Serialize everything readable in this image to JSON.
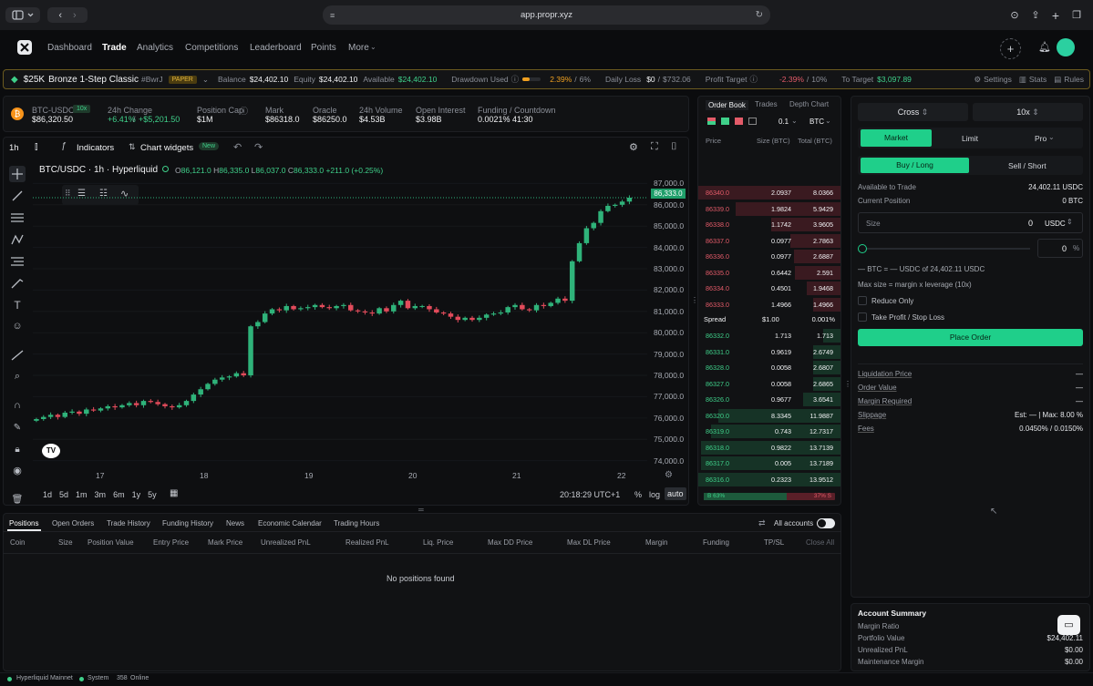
{
  "browser": {
    "url": "app.propr.xyz"
  },
  "nav": {
    "items": [
      "Dashboard",
      "Trade",
      "Analytics",
      "Competitions",
      "Leaderboard",
      "Points",
      "More"
    ],
    "active": "Trade"
  },
  "account": {
    "plan": "$25K",
    "challenge": "Bronze 1-Step Classic",
    "tag": "#BwrJ",
    "badge": "PAPER",
    "balance_label": "Balance",
    "balance": "$24,402.10",
    "equity_label": "Equity",
    "equity": "$24,402.10",
    "available_label": "Available",
    "available": "$24,402.10",
    "drawdown_label": "Drawdown Used",
    "drawdown_pct": "2.39%",
    "drawdown_max": "6%",
    "drawdown_fill": 0.4,
    "daily_loss_label": "Daily Loss",
    "daily_loss": "$0",
    "daily_loss_max": "$732.06",
    "profit_target_label": "Profit Target",
    "profit_target_pct": "-2.39%",
    "profit_target_max": "10%",
    "to_target_label": "To Target",
    "to_target": "$3,097.89",
    "settings": "Settings",
    "stats": "Stats",
    "rules": "Rules"
  },
  "ticker": {
    "pair": "BTC-USDC",
    "leverage": "10x",
    "price": "$86,320.50",
    "change_label": "24h Change",
    "change_pct": "+6.41%",
    "change_abs": "+$5,201.50",
    "cap_label": "Position Cap",
    "cap": "$1M",
    "mark_label": "Mark",
    "mark": "$86318.0",
    "oracle_label": "Oracle",
    "oracle": "$86250.0",
    "volume_label": "24h Volume",
    "volume": "$4.53B",
    "oi_label": "Open Interest",
    "oi": "$3.98B",
    "funding_label": "Funding / Countdown",
    "funding": "0.0021%",
    "countdown": "41:30"
  },
  "chart_toolbar": {
    "interval": "1h",
    "indicators": "Indicators",
    "widgets": "Chart widgets",
    "new_badge": "New"
  },
  "chart_legend": {
    "symbol": "BTC/USDC · 1h · Hyperliquid",
    "o": "86,121.0",
    "h": "86,335.0",
    "l": "86,037.0",
    "c": "86,333.0",
    "chg": "+211.0 (+0.25%)"
  },
  "chart_footer": {
    "ranges": [
      "1d",
      "5d",
      "1m",
      "3m",
      "6m",
      "1y",
      "5y"
    ],
    "time": "20:18:29 UTC+1",
    "pct": "%",
    "log": "log",
    "auto": "auto"
  },
  "chart_data": {
    "type": "candlestick",
    "y_ticks": [
      "87,000.0",
      "86,000.0",
      "85,000.0",
      "84,000.0",
      "83,000.0",
      "82,000.0",
      "81,000.0",
      "80,000.0",
      "79,000.0",
      "78,000.0",
      "77,000.0",
      "76,000.0",
      "75,000.0",
      "74,000.0"
    ],
    "y_tick_values": [
      87000,
      86000,
      85000,
      84000,
      83000,
      82000,
      81000,
      80000,
      79000,
      78000,
      77000,
      76000,
      75000,
      74000
    ],
    "x_ticks": [
      "17",
      "18",
      "19",
      "20",
      "21",
      "22"
    ],
    "ylim": [
      73600,
      87700
    ],
    "last_price": "86,333.0",
    "up_color": "#2fb37a",
    "down_color": "#e24b5b",
    "closes": [
      75950,
      76050,
      76150,
      76050,
      76250,
      76300,
      76200,
      76400,
      76350,
      76450,
      76550,
      76500,
      76600,
      76700,
      76600,
      76800,
      76750,
      76650,
      76550,
      76500,
      76600,
      76800,
      77100,
      77350,
      77600,
      77800,
      77900,
      77950,
      78100,
      78000,
      80300,
      80500,
      80900,
      81100,
      81050,
      81250,
      81100,
      81150,
      81200,
      81300,
      81200,
      81150,
      81250,
      81300,
      81050,
      81000,
      80950,
      80900,
      81150,
      81000,
      81300,
      81500,
      81150,
      81250,
      81250,
      81100,
      80950,
      80900,
      80750,
      80600,
      80700,
      80600,
      80700,
      80850,
      80900,
      80950,
      81200,
      81300,
      81100,
      81050,
      81300,
      81250,
      81400,
      81600,
      81500,
      83350,
      84200,
      84900,
      85150,
      85700,
      85950,
      86000,
      86150,
      86333
    ]
  },
  "orderbook": {
    "tabs": [
      "Order Book",
      "Trades",
      "Depth Chart"
    ],
    "tick": "0.1",
    "unit": "BTC",
    "headers": [
      "Price",
      "Size (BTC)",
      "Total (BTC)"
    ],
    "asks": [
      [
        "86340.0",
        "2.0937",
        "8.0366",
        1.0
      ],
      [
        "86339.0",
        "1.9824",
        "5.9429",
        0.74
      ],
      [
        "86338.0",
        "1.1742",
        "3.9605",
        0.49
      ],
      [
        "86337.0",
        "0.0977",
        "2.7863",
        0.35
      ],
      [
        "86336.0",
        "0.0977",
        "2.6887",
        0.33
      ],
      [
        "86335.0",
        "0.6442",
        "2.591",
        0.32
      ],
      [
        "86334.0",
        "0.4501",
        "1.9468",
        0.24
      ],
      [
        "86333.0",
        "1.4966",
        "1.4966",
        0.19
      ]
    ],
    "spread_label": "Spread",
    "spread": "$1.00",
    "spread_pct": "0.001%",
    "bids": [
      [
        "86332.0",
        "1.713",
        "1.713",
        0.12
      ],
      [
        "86331.0",
        "0.9619",
        "2.6749",
        0.19
      ],
      [
        "86328.0",
        "0.0058",
        "2.6807",
        0.19
      ],
      [
        "86327.0",
        "0.0058",
        "2.6865",
        0.19
      ],
      [
        "86326.0",
        "0.9677",
        "3.6541",
        0.26
      ],
      [
        "86320.0",
        "8.3345",
        "11.9887",
        0.86
      ],
      [
        "86319.0",
        "0.743",
        "12.7317",
        0.91
      ],
      [
        "86318.0",
        "0.9822",
        "13.7139",
        0.98
      ],
      [
        "86317.0",
        "0.005",
        "13.7189",
        0.98
      ],
      [
        "86316.0",
        "0.2323",
        "13.9512",
        1.0
      ]
    ],
    "buy_pct": "B 63%",
    "sell_pct": "37% S",
    "buy_frac": 0.63
  },
  "order_form": {
    "margin_mode": "Cross",
    "leverage": "10x",
    "types": [
      "Market",
      "Limit",
      "Pro"
    ],
    "sides": [
      "Buy / Long",
      "Sell / Short"
    ],
    "available_label": "Available to Trade",
    "available": "24,402.11 USDC",
    "position_label": "Current Position",
    "position": "0 BTC",
    "size_label": "Size",
    "size_value": "0",
    "size_unit": "USDC",
    "pct_value": "0",
    "pct_unit": "%",
    "conversion": "— BTC = — USDC of 24,402.11 USDC",
    "max_size": "Max size = margin x leverage (10x)",
    "reduce_only": "Reduce Only",
    "tpsl": "Take Profit / Stop Loss",
    "submit": "Place Order",
    "details": [
      [
        "Liquidation Price",
        "—"
      ],
      [
        "Order Value",
        "—"
      ],
      [
        "Margin Required",
        "—"
      ],
      [
        "Slippage",
        "Est: — | Max: 8.00 %"
      ],
      [
        "Fees",
        "0.0450% / 0.0150%"
      ]
    ]
  },
  "account_summary": {
    "title": "Account Summary",
    "rows": [
      [
        "Margin Ratio",
        ""
      ],
      [
        "Portfolio Value",
        "$24,402.11"
      ],
      [
        "Unrealized PnL",
        "$0.00"
      ],
      [
        "Maintenance Margin",
        "$0.00"
      ]
    ]
  },
  "positions": {
    "tabs": [
      "Positions",
      "Open Orders",
      "Trade History",
      "Funding History",
      "News",
      "Economic Calendar",
      "Trading Hours"
    ],
    "all_accounts": "All accounts",
    "headers": [
      "Coin",
      "Size",
      "Position Value",
      "Entry Price",
      "Mark Price",
      "Unrealized PnL",
      "Realized PnL",
      "Liq. Price",
      "Max DD Price",
      "Max DL Price",
      "Margin",
      "Funding",
      "TP/SL",
      "Close All"
    ],
    "empty": "No positions found"
  },
  "status": {
    "network": "Hyperliquid Mainnet",
    "system": "System",
    "online_count": "358",
    "online": "Online"
  }
}
